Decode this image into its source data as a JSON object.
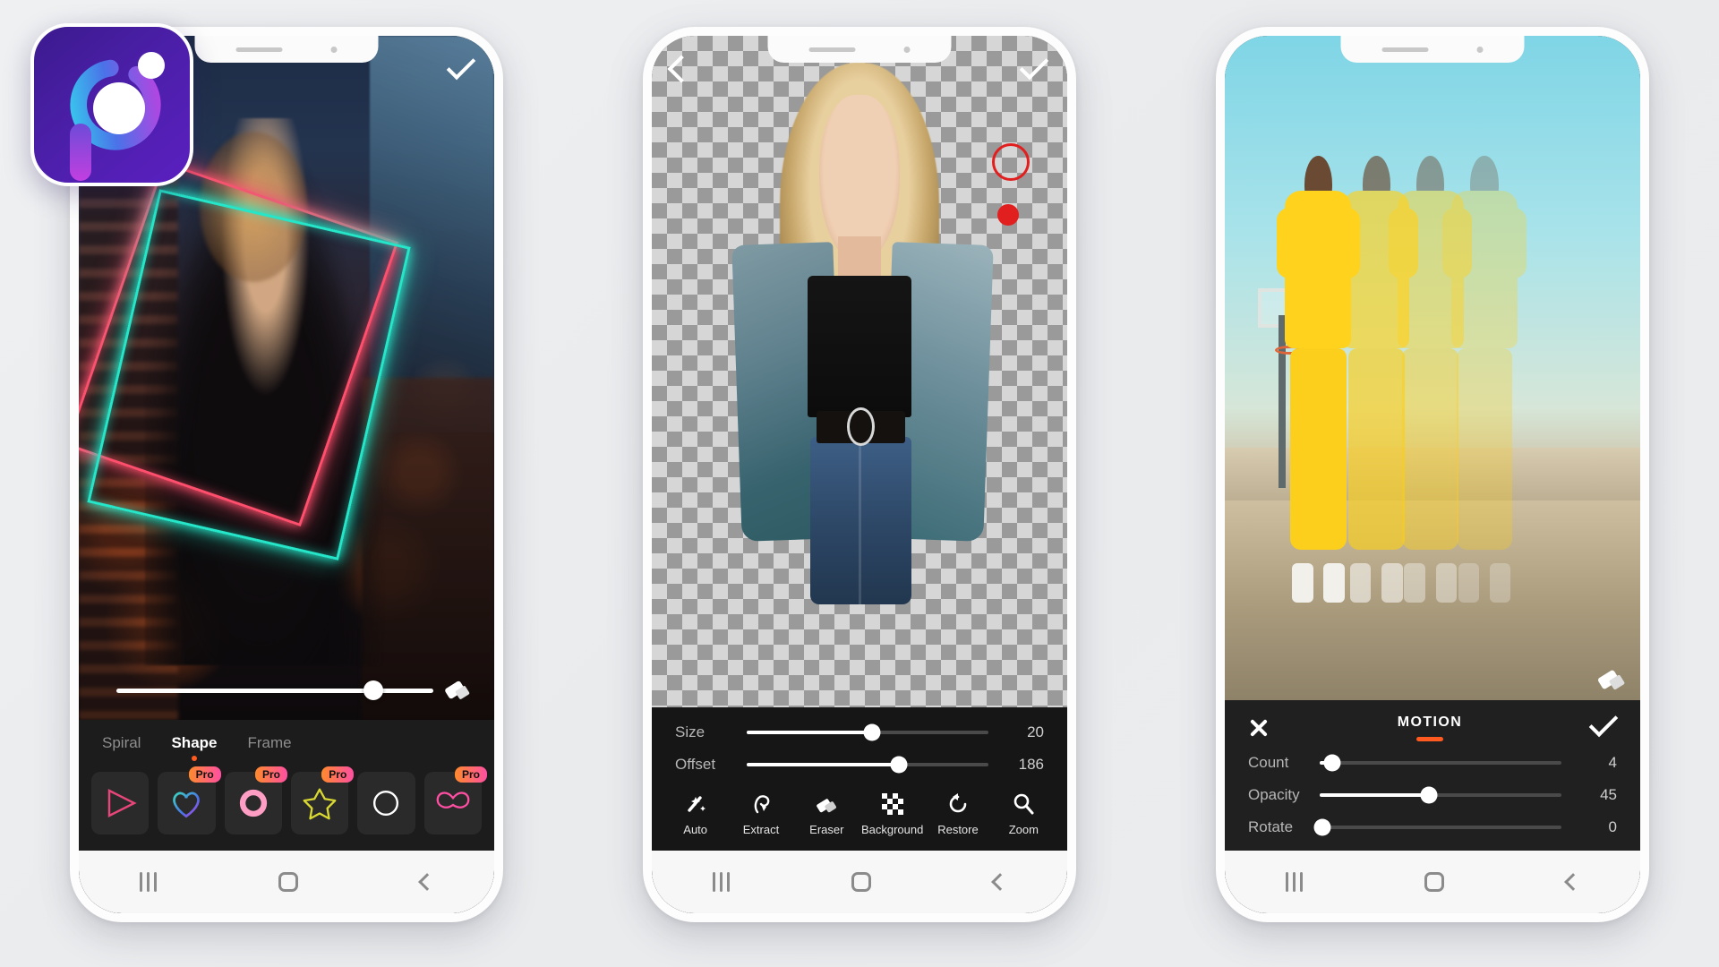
{
  "app": {
    "icon_name": "photo-editor-app-icon"
  },
  "phone1": {
    "name": "neon-shape-editor",
    "topbar": {
      "confirm_label": "✓"
    },
    "slider": {
      "value_pct": 81,
      "eraser_icon": "eraser-icon"
    },
    "tabs": [
      {
        "label": "Spiral",
        "active": false
      },
      {
        "label": "Shape",
        "active": true
      },
      {
        "label": "Frame",
        "active": false
      }
    ],
    "thumbs": [
      {
        "name": "shape-triangle",
        "pro": false,
        "color": "#e8467a"
      },
      {
        "name": "shape-heart",
        "pro": true,
        "pro_label": "Pro",
        "color": "#3bd6c0"
      },
      {
        "name": "shape-circle-glow",
        "pro": true,
        "pro_label": "Pro",
        "color": "#ff9ec4"
      },
      {
        "name": "shape-star",
        "pro": true,
        "pro_label": "Pro",
        "color": "#d9d832"
      },
      {
        "name": "shape-ring",
        "pro": false,
        "color": "#ffffff"
      },
      {
        "name": "shape-wings",
        "pro": true,
        "pro_label": "Pro",
        "color": "#ff4fa3"
      }
    ],
    "navbar": {
      "recents": "recents-icon",
      "home": "home-icon",
      "back": "back-icon"
    }
  },
  "phone2": {
    "name": "background-cutout-editor",
    "topbar": {
      "back_label": "‹",
      "confirm_label": "✓"
    },
    "brush": {
      "outline_color": "#e21f1f",
      "fill_color": "#e21f1f"
    },
    "sliders": [
      {
        "label": "Size",
        "value": "20",
        "fill_pct": 52,
        "knob_pct": 52
      },
      {
        "label": "Offset",
        "value": "186",
        "fill_pct": 63,
        "knob_pct": 63
      }
    ],
    "tools": [
      {
        "label": "Auto",
        "icon": "magic-wand-icon"
      },
      {
        "label": "Extract",
        "icon": "lasso-pen-icon"
      },
      {
        "label": "Eraser",
        "icon": "eraser-icon"
      },
      {
        "label": "Background",
        "icon": "checkerboard-icon"
      },
      {
        "label": "Restore",
        "icon": "restore-undo-icon"
      },
      {
        "label": "Zoom",
        "icon": "magnifier-icon"
      }
    ]
  },
  "phone3": {
    "name": "motion-effect-editor",
    "panel_title": "MOTION",
    "close_label": "close-icon",
    "confirm_label": "✓",
    "accent_color": "#ff5a1f",
    "eraser_icon": "eraser-icon",
    "sliders": [
      {
        "label": "Count",
        "value": "4",
        "fill_pct": 3,
        "knob_pct": 5
      },
      {
        "label": "Opacity",
        "value": "45",
        "fill_pct": 45,
        "knob_pct": 45
      },
      {
        "label": "Rotate",
        "value": "0",
        "fill_pct": 0,
        "knob_pct": 1
      }
    ]
  }
}
